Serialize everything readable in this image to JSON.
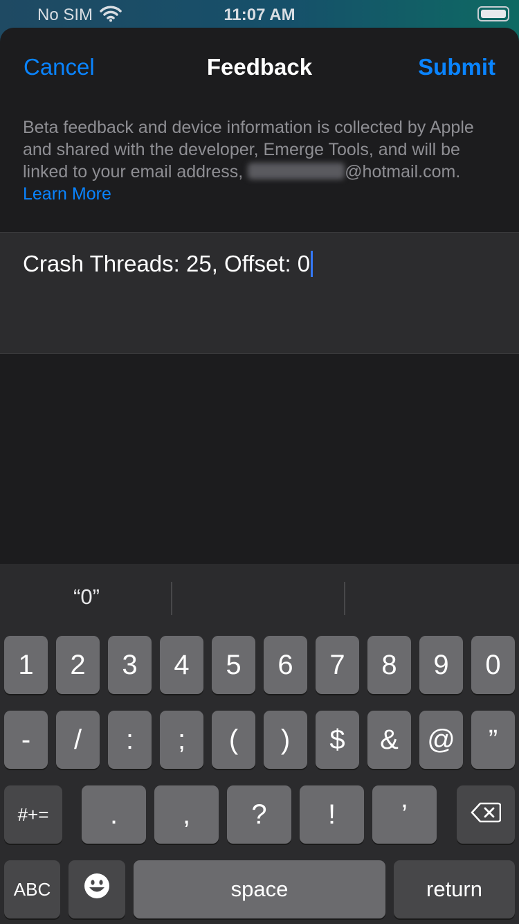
{
  "status_bar": {
    "carrier": "No SIM",
    "time": "11:07 AM",
    "wifi_icon": "wifi-icon",
    "battery_icon": "battery-icon"
  },
  "nav": {
    "cancel_label": "Cancel",
    "title": "Feedback",
    "submit_label": "Submit"
  },
  "disclaimer": {
    "text": "Beta feedback and device information is collected by Apple and shared with the developer, Emerge Tools, and will be linked to your email address,",
    "email_domain": "@hotmail.com.",
    "learn_more": "Learn More"
  },
  "feedback": {
    "value": "Crash Threads: 25, Offset: 0"
  },
  "keyboard": {
    "suggestions": [
      "“0”",
      "",
      ""
    ],
    "row1": [
      "1",
      "2",
      "3",
      "4",
      "5",
      "6",
      "7",
      "8",
      "9",
      "0"
    ],
    "row2": [
      "-",
      "/",
      ":",
      ";",
      "(",
      ")",
      "$",
      "&",
      "@",
      "”"
    ],
    "row3": {
      "shift_label": "#+=",
      "keys": [
        ".",
        ",",
        "?",
        "!",
        "’"
      ],
      "delete_icon": "backspace-icon"
    },
    "row4": {
      "abc_label": "ABC",
      "emoji_icon": "emoji-icon",
      "space_label": "space",
      "return_label": "return"
    }
  },
  "colors": {
    "accent": "#0a84ff",
    "sheet_bg": "#1c1c1e",
    "key_bg": "#6b6b6e",
    "key_dark_bg": "#474749"
  }
}
